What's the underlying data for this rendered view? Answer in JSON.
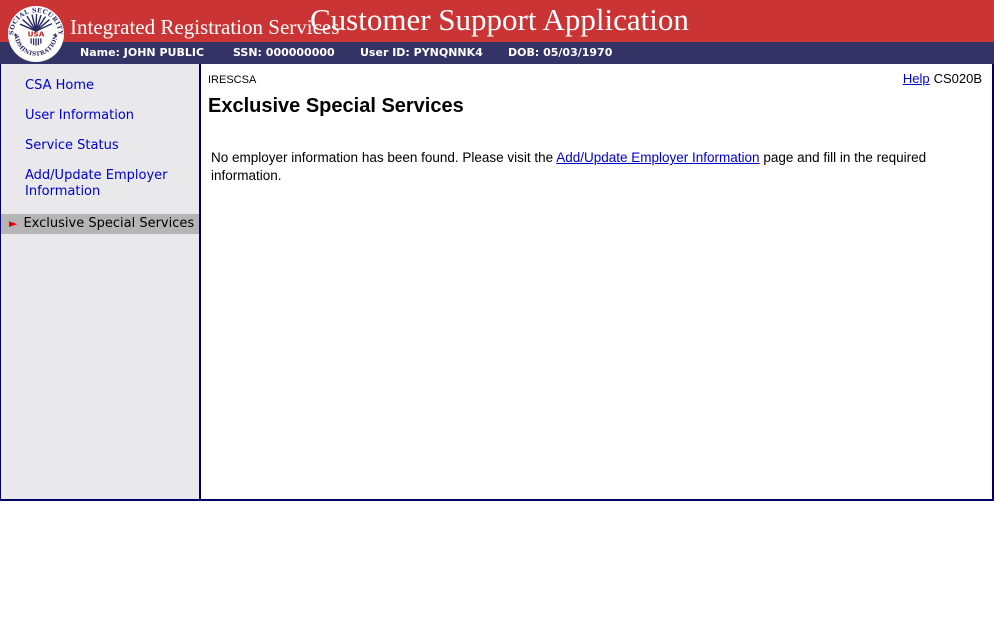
{
  "colors": {
    "banner_red": "#CB3434",
    "bar_navy": "#333366",
    "border_navy": "#000066",
    "sidebar_bg": "#E9E9EB",
    "active_item_bg": "#B5B5B5",
    "link_blue": "#0000CC",
    "arrow_red": "#E80000"
  },
  "header": {
    "seal": {
      "top_text": "SOCIAL SECURITY",
      "bottom_text": "ADMINISTRATION",
      "center_text": "USA"
    },
    "org_title": "Integrated Registration Services",
    "app_title": "Customer Support Application"
  },
  "userbar": {
    "items": [
      "Name: JOHN PUBLIC",
      "SSN: 000000000",
      "User ID: PYNQNNK4",
      "DOB: 05/03/1970"
    ]
  },
  "sidebar": {
    "active_marker": "►",
    "items": [
      {
        "label": "CSA Home",
        "active": false
      },
      {
        "label": "User Information",
        "active": false
      },
      {
        "label": "Service Status",
        "active": false
      },
      {
        "label": "Add/Update Employer Information",
        "active": false
      },
      {
        "label": "Exclusive Special Services",
        "active": true
      }
    ]
  },
  "main": {
    "app_code": "IRESCSA",
    "help_label": "Help",
    "screen_id": "CS020B",
    "title": "Exclusive Special Services",
    "message": {
      "pre": "No employer information has been found. Please visit the ",
      "link": "Add/Update Employer Information",
      "post": " page and fill in the required information."
    }
  }
}
